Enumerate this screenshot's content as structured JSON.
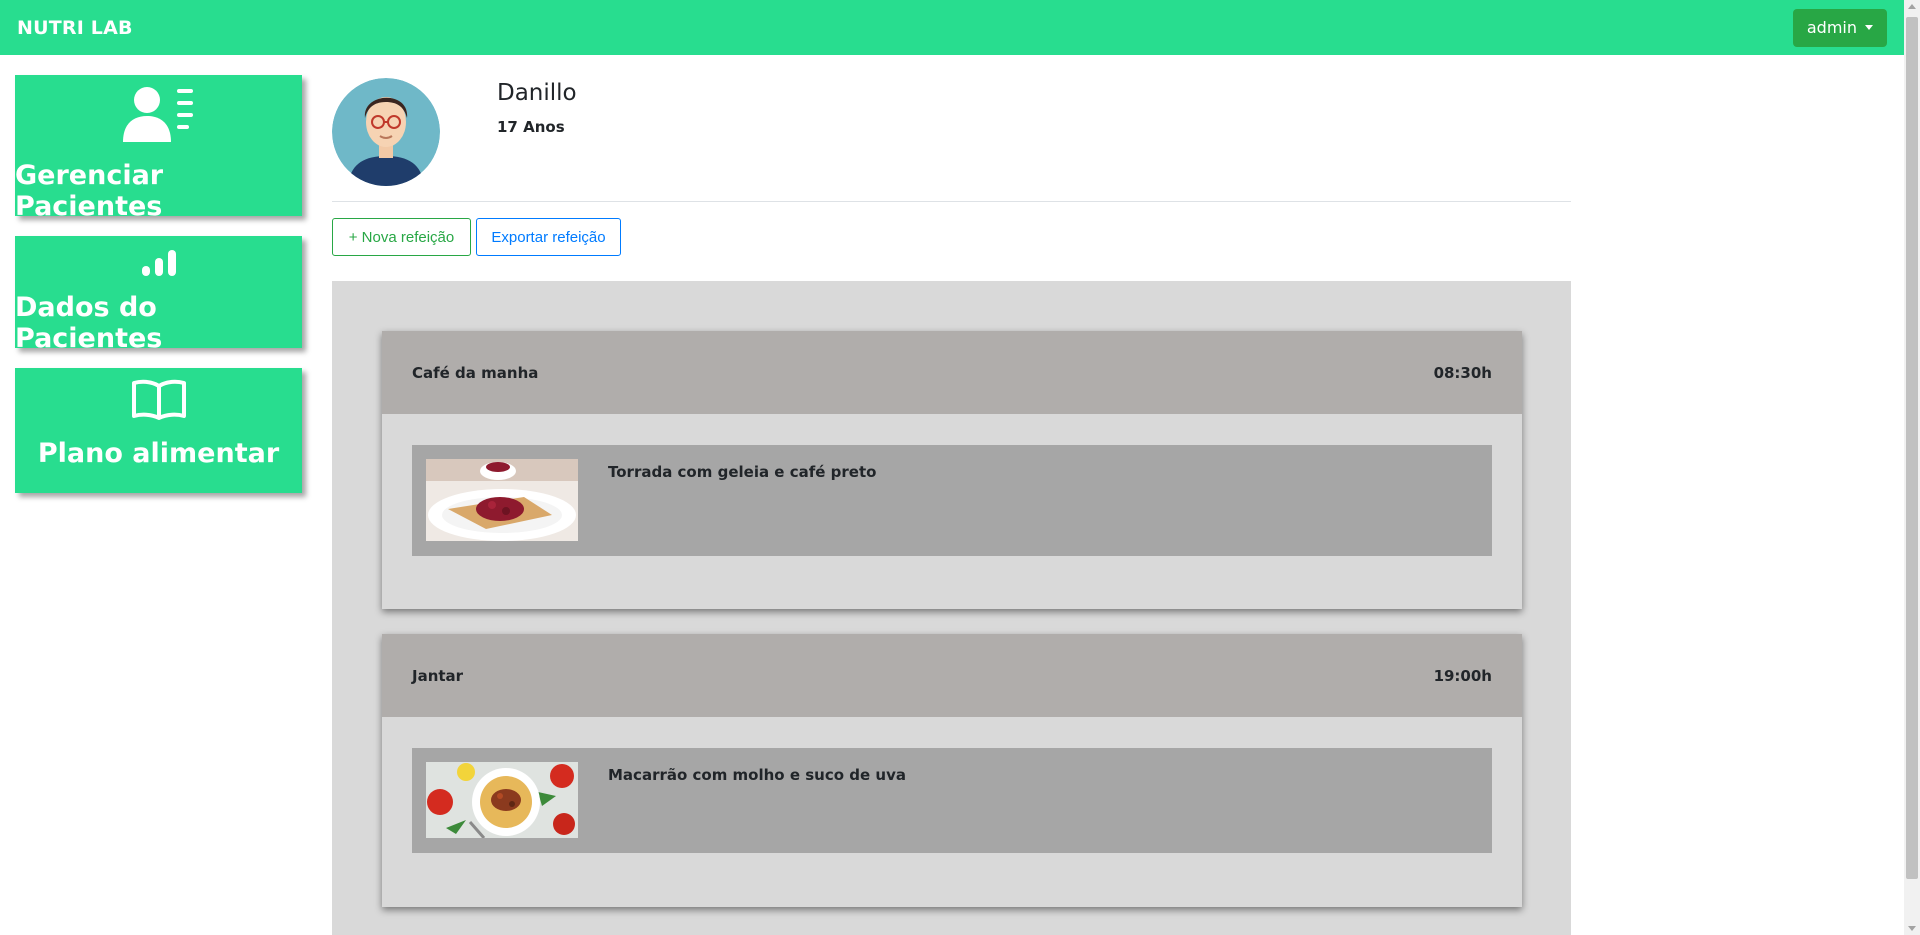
{
  "navbar": {
    "brand": "NUTRI LAB",
    "user_menu_label": "admin"
  },
  "sidebar": {
    "items": [
      {
        "label": "Gerenciar Pacientes",
        "icon": "user-list-icon"
      },
      {
        "label": "Dados do Pacientes",
        "icon": "signal-bars-icon"
      },
      {
        "label": "Plano alimentar",
        "icon": "open-book-icon"
      }
    ]
  },
  "patient": {
    "name": "Danillo",
    "age": "17 Anos"
  },
  "actions": {
    "new_meal_label": "+ Nova refeição",
    "export_meal_label": "Exportar refeição"
  },
  "meals": [
    {
      "name": "Café da manha",
      "time": "08:30h",
      "items": [
        {
          "description": "Torrada com geleia e café preto"
        }
      ]
    },
    {
      "name": "Jantar",
      "time": "19:00h",
      "items": [
        {
          "description": "Macarrão com molho e suco de uva"
        }
      ]
    }
  ],
  "colors": {
    "brand_green": "#28dd8f",
    "admin_green": "#28a745",
    "meal_header": "#b0adab",
    "meal_item": "#a6a6a6"
  }
}
